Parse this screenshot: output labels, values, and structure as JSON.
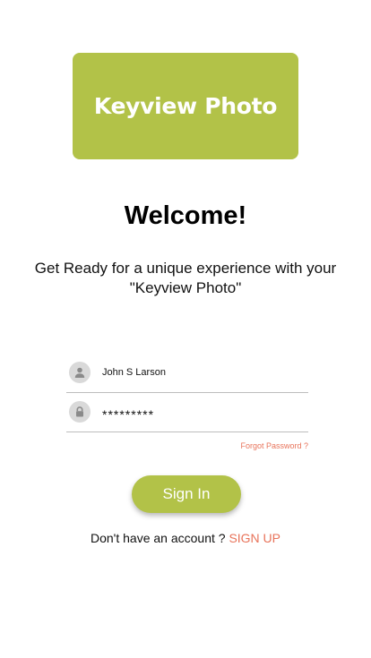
{
  "logo": {
    "text": "Keyview Photo"
  },
  "welcome": {
    "title": "Welcome!",
    "subtitle": "Get Ready for a unique experience with your \"Keyview Photo\""
  },
  "form": {
    "username_value": "John S Larson",
    "password_value": "*********",
    "forgot_password": "Forgot Password ?"
  },
  "signin": {
    "label": "Sign In"
  },
  "signup": {
    "prompt": "Don't have an account ? ",
    "link": "SIGN UP"
  },
  "colors": {
    "accent": "#b2c248",
    "link": "#e8735a",
    "icon_bg": "#d9d9d9"
  },
  "icons": {
    "username": "user-icon",
    "password": "lock-icon"
  }
}
